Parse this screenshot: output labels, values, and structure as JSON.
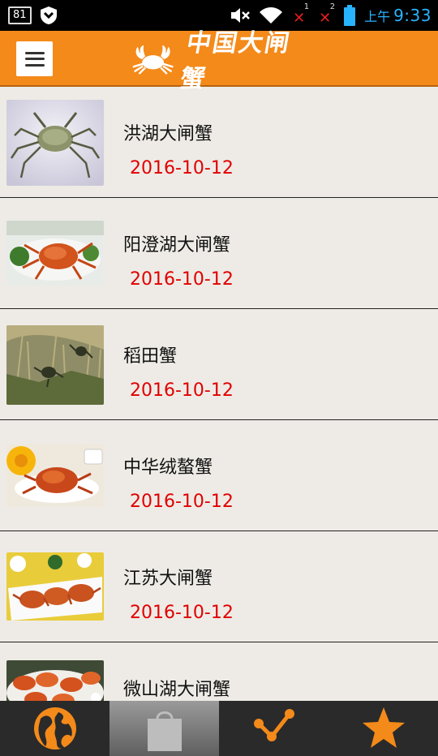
{
  "status_bar": {
    "notification_count": "81",
    "ampm": "上午",
    "time": "9:33",
    "sim1": "1",
    "sim2": "2"
  },
  "header": {
    "logo_text": "中国大闸蟹"
  },
  "items": [
    {
      "name": "洪湖大闸蟹",
      "date": "2016-10-12"
    },
    {
      "name": "阳澄湖大闸蟹",
      "date": "2016-10-12"
    },
    {
      "name": "稻田蟹",
      "date": "2016-10-12"
    },
    {
      "name": "中华绒螯蟹",
      "date": "2016-10-12"
    },
    {
      "name": "江苏大闸蟹",
      "date": "2016-10-12"
    },
    {
      "name": "微山湖大闸蟹",
      "date": ""
    }
  ],
  "tabs": [
    {
      "icon": "globe-icon",
      "active": false
    },
    {
      "icon": "shopping-bag-icon",
      "active": true
    },
    {
      "icon": "share-icon",
      "active": false
    },
    {
      "icon": "star-icon",
      "active": false
    }
  ],
  "colors": {
    "header": "#f48a1a",
    "date": "#e00000",
    "tab_icon": "#f48a1a",
    "time": "#28b3ff"
  }
}
